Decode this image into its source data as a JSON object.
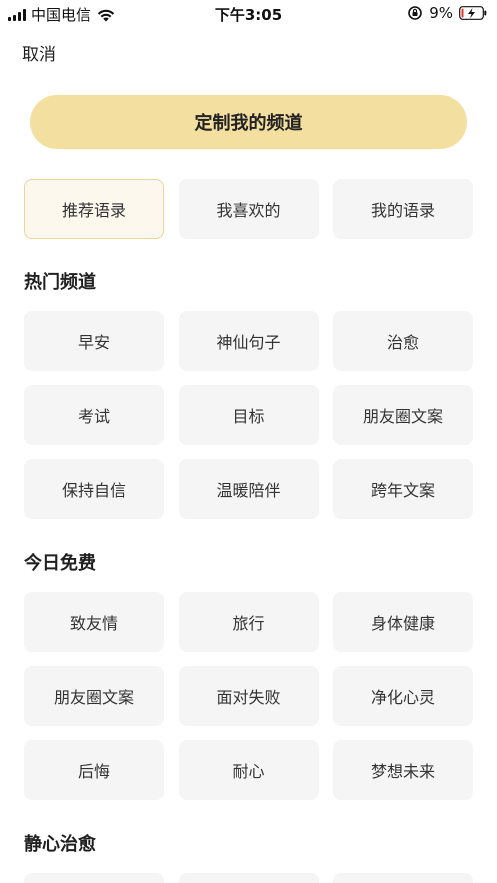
{
  "status_bar": {
    "carrier": "中国电信",
    "time": "下午3:05",
    "battery_percent": "9%",
    "battery_level": 0.09,
    "battery_color": "#e5362c",
    "icons": [
      "signal-icon",
      "wifi-icon",
      "orientation-lock-icon",
      "battery-charging-icon"
    ]
  },
  "header": {
    "cancel_label": "取消"
  },
  "customize_button": {
    "label": "定制我的频道",
    "color": "#f3df9f"
  },
  "top_tabs": [
    {
      "label": "推荐语录",
      "active": true
    },
    {
      "label": "我喜欢的",
      "active": false
    },
    {
      "label": "我的语录",
      "active": false
    }
  ],
  "sections": [
    {
      "title": "热门频道",
      "items": [
        "早安",
        "神仙句子",
        "治愈",
        "考试",
        "目标",
        "朋友圈文案",
        "保持自信",
        "温暖陪伴",
        "跨年文案"
      ]
    },
    {
      "title": "今日免费",
      "items": [
        "致友情",
        "旅行",
        "身体健康",
        "朋友圈文案",
        "面对失败",
        "净化心灵",
        "后悔",
        "耐心",
        "梦想未来"
      ]
    },
    {
      "title": "静心治愈",
      "items": [
        "",
        "",
        ""
      ]
    }
  ],
  "colors": {
    "chip_background": "#f5f5f5",
    "active_chip_background": "#fdf8ee",
    "active_chip_border": "#ecd59a"
  }
}
